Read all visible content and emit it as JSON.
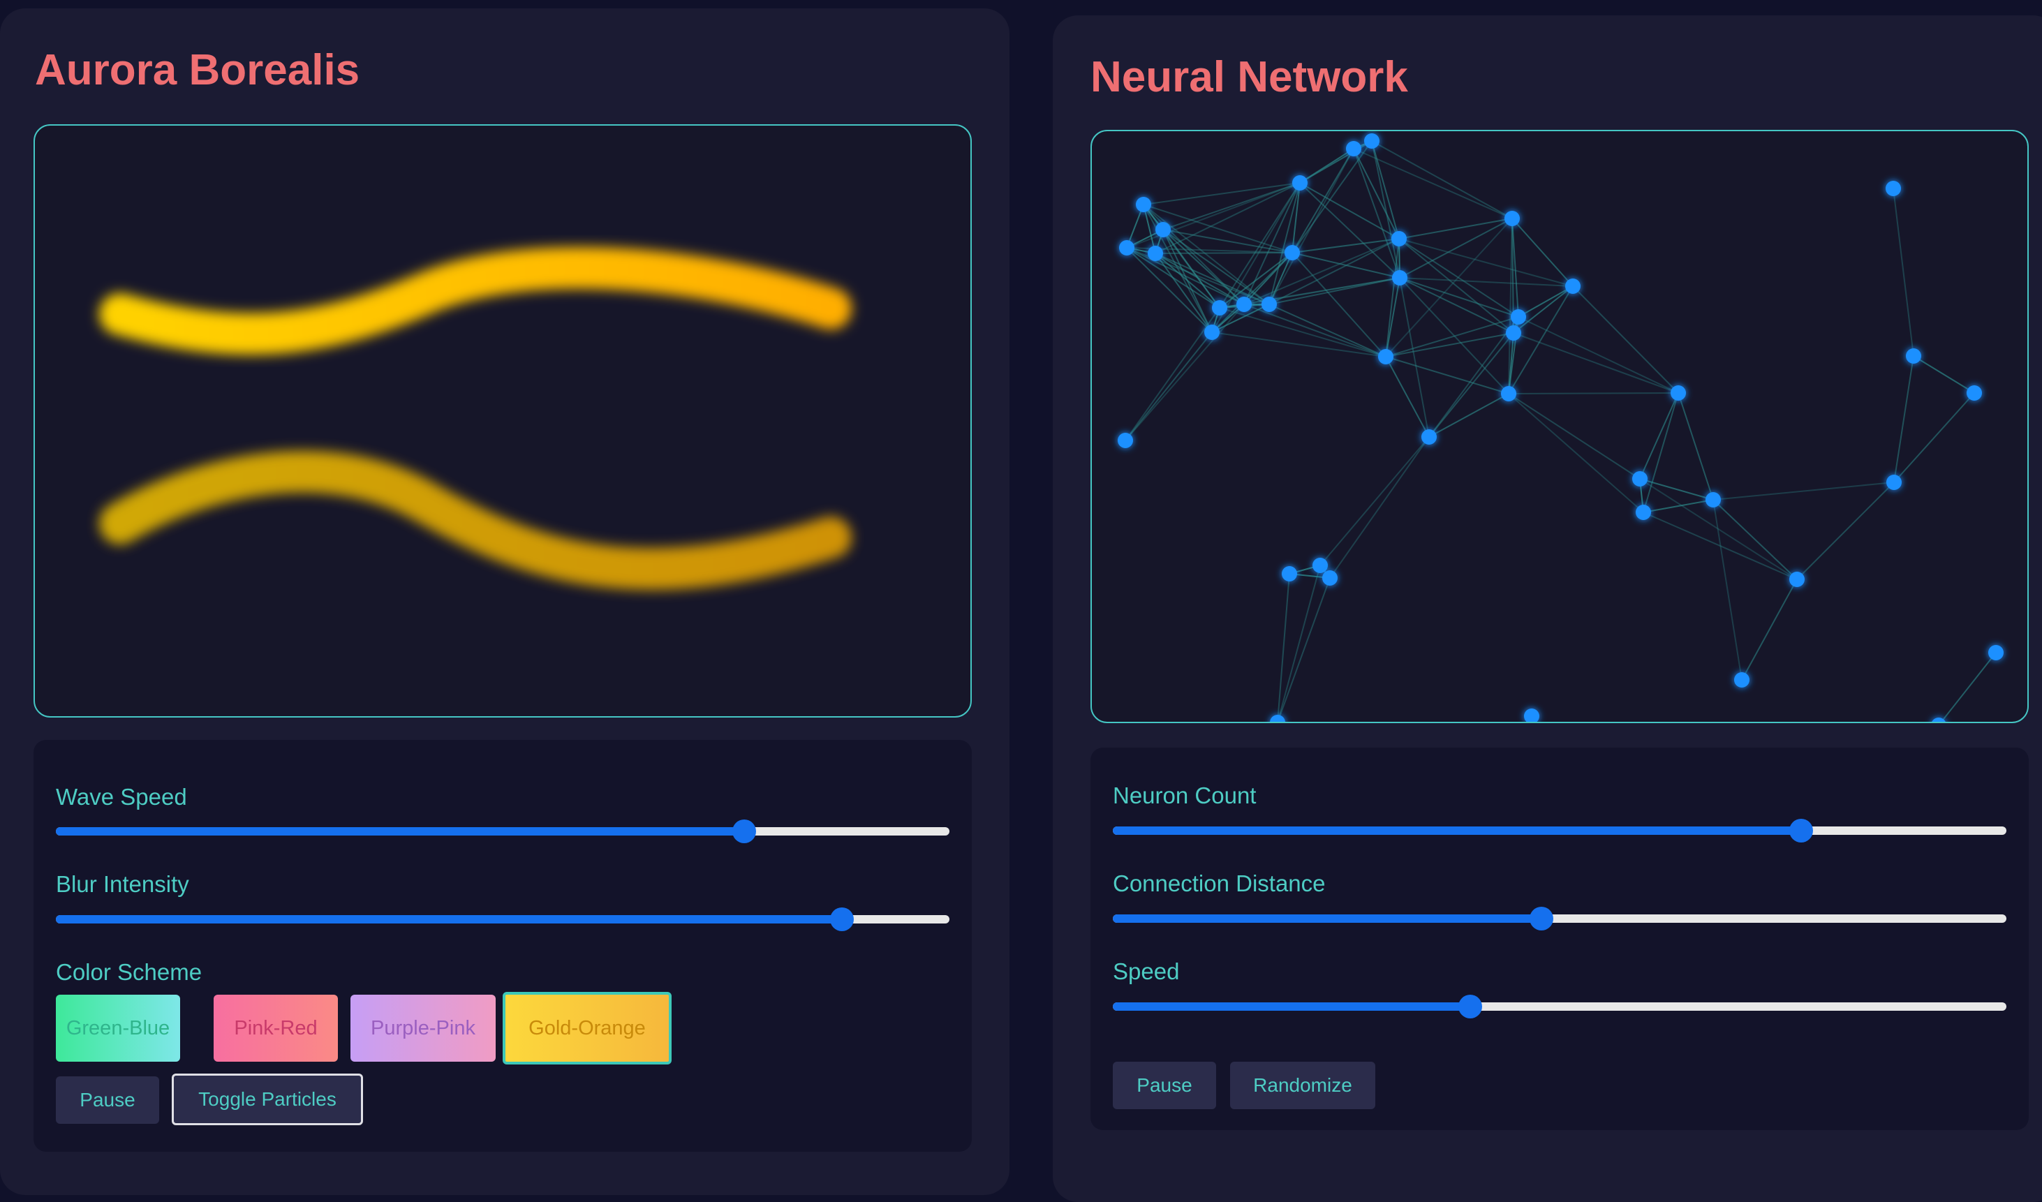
{
  "aurora": {
    "title": "Aurora Borealis",
    "controls": {
      "wave_speed": {
        "label": "Wave Speed",
        "value": 0.77
      },
      "blur_intensity": {
        "label": "Blur Intensity",
        "value": 0.88
      },
      "color_scheme": {
        "label": "Color Scheme",
        "options": [
          "Green-Blue",
          "Pink-Red",
          "Purple-Pink",
          "Gold-Orange"
        ],
        "selected": "Gold-Orange"
      },
      "pause_label": "Pause",
      "toggle_particles_label": "Toggle Particles"
    },
    "wave_colors": [
      "#ffd200",
      "#ffae00"
    ]
  },
  "neural": {
    "title": "Neural Network",
    "controls": {
      "neuron_count": {
        "label": "Neuron Count",
        "value": 0.77
      },
      "connection_distance": {
        "label": "Connection Distance",
        "value": 0.48
      },
      "speed": {
        "label": "Speed",
        "value": 0.4
      },
      "pause_label": "Pause",
      "randomize_label": "Randomize"
    },
    "node_color": "#1e90ff",
    "edge_color": "#2d8c8c"
  },
  "colors": {
    "background": "#10112a",
    "panel": "#1b1b33",
    "accent_title": "#ef6f72",
    "accent_teal": "#4ecdc4",
    "slider_fill": "#1570ee"
  }
}
